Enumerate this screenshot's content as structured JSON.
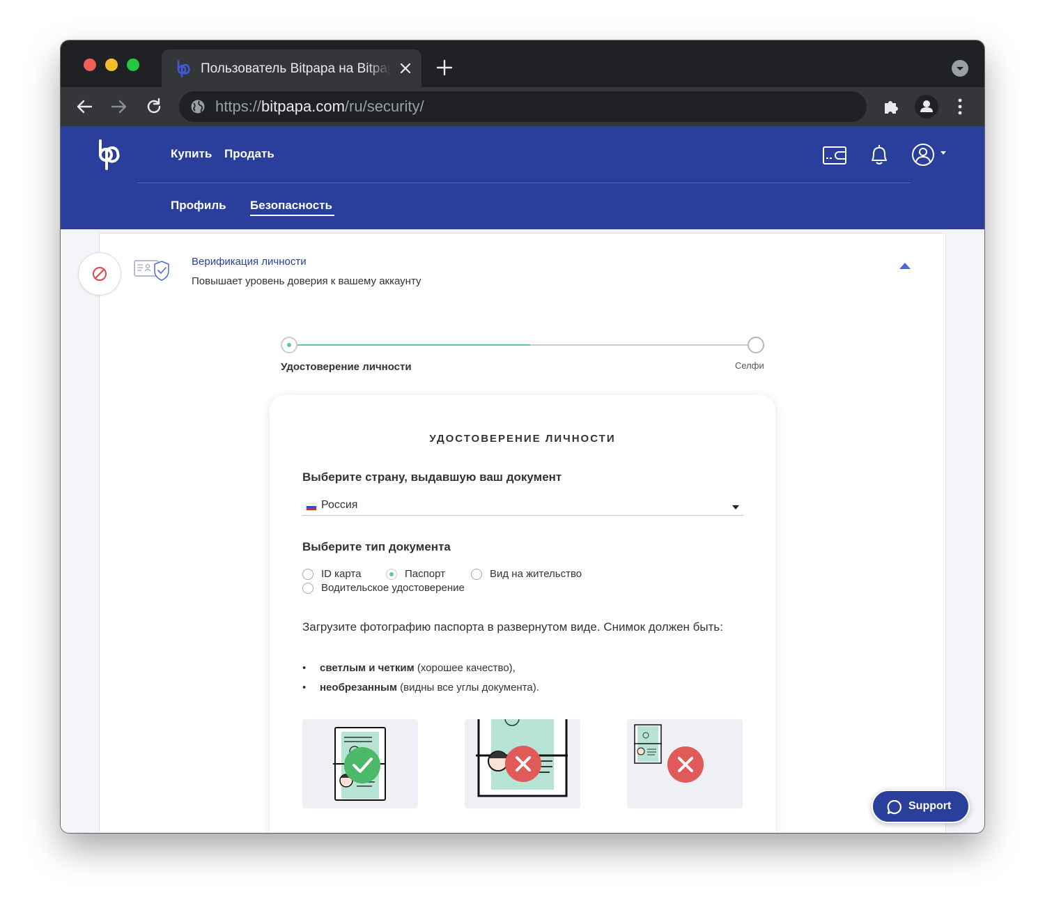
{
  "browser": {
    "tab_title": "Пользователь Bitpapa на Bitpapa",
    "url_scheme": "https://",
    "url_host": "bitpapa.com",
    "url_path": "/ru/security/",
    "icons": [
      "back-arrow-icon",
      "forward-arrow-icon",
      "reload-icon",
      "globe-icon",
      "puzzle-extension-icon",
      "profile-icon",
      "kebab-menu-icon",
      "tab-search-icon",
      "new-tab-icon",
      "close-icon"
    ]
  },
  "header": {
    "nav": {
      "buy": "Купить",
      "sell": "Продать"
    },
    "subnav": {
      "profile": "Профиль",
      "security": "Безопасность"
    },
    "icons": [
      "wallet-icon",
      "bell-icon",
      "user-account-icon",
      "chevron-down-icon"
    ]
  },
  "verification": {
    "title": "Верификация личности",
    "subtitle": "Повышает уровень доверия к вашему аккаунту",
    "status_icon": "blocked-icon",
    "section_icon": "id-card-shield-icon"
  },
  "stepper": {
    "steps": [
      {
        "label": "Удостоверение личности",
        "active": true
      },
      {
        "label": "Селфи",
        "active": false
      }
    ]
  },
  "form": {
    "card_title": "УДОСТОВЕРЕНИЕ ЛИЧНОСТИ",
    "country_question": "Выберите страну, выдавшую ваш документ",
    "country_value": "Россия",
    "doc_type_question": "Выберите тип документа",
    "doc_types": [
      {
        "label": "ID карта",
        "checked": false
      },
      {
        "label": "Паспорт",
        "checked": true
      },
      {
        "label": "Вид на жительство",
        "checked": false
      },
      {
        "label": "Водительское удостоверение",
        "checked": false
      }
    ],
    "instruction": "Загрузите фотографию паспорта в развернутом виде. Снимок должен быть:",
    "requirements": [
      {
        "bold": "светлым и четким",
        "text": " (хорошее качество),"
      },
      {
        "bold": "необрезанным",
        "text": " (видны все углы документа)."
      }
    ],
    "examples": [
      {
        "name": "full-spread",
        "status": "correct"
      },
      {
        "name": "cropped-closeup",
        "status": "incorrect"
      },
      {
        "name": "too-far-away",
        "status": "incorrect"
      }
    ]
  },
  "support": {
    "label": "Support"
  },
  "colors": {
    "brand": "#2a3f9c",
    "accent": "#5cc5b2",
    "error": "#e05a5a",
    "background": "#f4f5f8"
  }
}
